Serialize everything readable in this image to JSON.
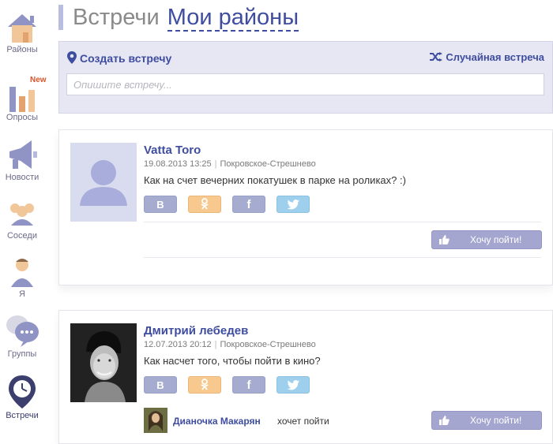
{
  "sidebar": {
    "items": [
      {
        "label": "Районы",
        "icon": "house-icon"
      },
      {
        "label": "Опросы",
        "icon": "bar-chart-icon",
        "badge": "New"
      },
      {
        "label": "Новости",
        "icon": "megaphone-icon"
      },
      {
        "label": "Соседи",
        "icon": "neighbors-icon"
      },
      {
        "label": "Я",
        "icon": "person-icon"
      },
      {
        "label": "Группы",
        "icon": "chat-bubbles-icon"
      },
      {
        "label": "Встречи",
        "icon": "map-pin-clock-icon",
        "active": true
      }
    ]
  },
  "header": {
    "title": "Встречи",
    "title_link": "Мои районы"
  },
  "create_panel": {
    "create_label": "Создать встречу",
    "random_label": "Случайная встреча",
    "input_placeholder": "Опишите встречу..."
  },
  "meetups": [
    {
      "author": "Vatta Toro",
      "date": "19.08.2013 13:25",
      "district": "Покровское-Стрешнево",
      "text": "Как на счет вечерних покатушек в парке на роликах? :)",
      "share": [
        "В",
        "ok",
        "f",
        "twitter"
      ],
      "want_label": "Хочу пойти!"
    },
    {
      "author": "Дмитрий лебедев",
      "date": "12.07.2013 20:12",
      "district": "Покровское-Стрешнево",
      "text": "Как насчет того, чтобы пойти в кино?",
      "share": [
        "В",
        "ok",
        "f",
        "twitter"
      ],
      "want_label": "Хочу пойти!",
      "joiner_name": "Дианочка Макарян",
      "joiner_action": "хочет пойти"
    }
  ],
  "colors": {
    "accent": "#3f4da0",
    "panel_bg": "#e6e7f2",
    "button": "#a4a6d0",
    "badge": "#d9542b"
  }
}
